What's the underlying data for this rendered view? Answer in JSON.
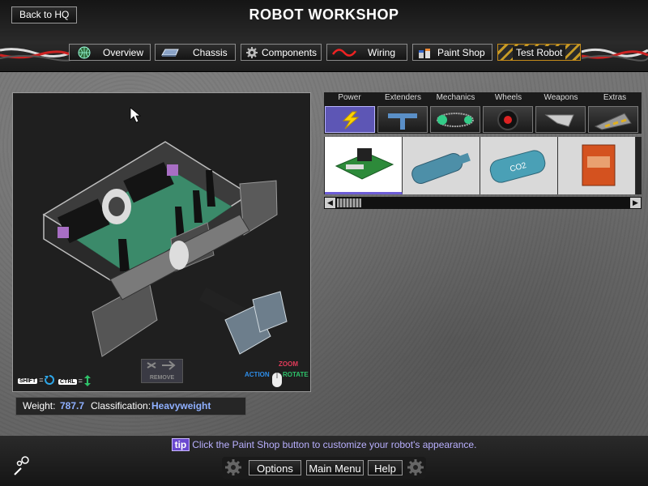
{
  "header": {
    "title": "ROBOT WORKSHOP",
    "back_label": "Back to HQ"
  },
  "tabs": [
    {
      "label": "Overview",
      "icon": "globe-icon"
    },
    {
      "label": "Chassis",
      "icon": "chassis-icon"
    },
    {
      "label": "Components",
      "icon": "gear-icon"
    },
    {
      "label": "Wiring",
      "icon": "wire-icon"
    },
    {
      "label": "Paint Shop",
      "icon": "paint-cans-icon"
    },
    {
      "label": "Test Robot",
      "icon": "hazard-stripes"
    }
  ],
  "viewport": {
    "controls": {
      "shift_key": "SHIFT",
      "ctrl_key": "CTRL",
      "eq": "=",
      "remove_label": "REMOVE",
      "action_label": "ACTION",
      "zoom_label": "ZOOM",
      "rotate_label": "ROTATE"
    }
  },
  "stats": {
    "weight_label": "Weight:",
    "weight_value": "787.7",
    "class_label": "Classification:",
    "class_value": "Heavyweight"
  },
  "parts": {
    "categories": [
      {
        "label": "Power",
        "icon": "lightning-icon",
        "selected": true
      },
      {
        "label": "Extenders",
        "icon": "extender-icon",
        "selected": false
      },
      {
        "label": "Mechanics",
        "icon": "chain-icon",
        "selected": false
      },
      {
        "label": "Wheels",
        "icon": "wheel-icon",
        "selected": false
      },
      {
        "label": "Weapons",
        "icon": "blade-icon",
        "selected": false
      },
      {
        "label": "Extras",
        "icon": "wedge-icon",
        "selected": false
      }
    ],
    "items": [
      {
        "name": "circuit-board-item",
        "selected": true
      },
      {
        "name": "blue-tank-item",
        "selected": false
      },
      {
        "name": "co2-tank-item",
        "text": "CO2",
        "selected": false
      },
      {
        "name": "battery-box-item",
        "selected": false
      }
    ]
  },
  "tip": {
    "badge": "tip",
    "text": "Click the Paint Shop button to customize your robot's appearance."
  },
  "footer": {
    "options": "Options",
    "main_menu": "Main Menu",
    "help": "Help"
  },
  "colors": {
    "accent_purple": "#6a48cf",
    "value_blue": "#8fb0ff",
    "hazard_yellow": "#c79a25"
  }
}
